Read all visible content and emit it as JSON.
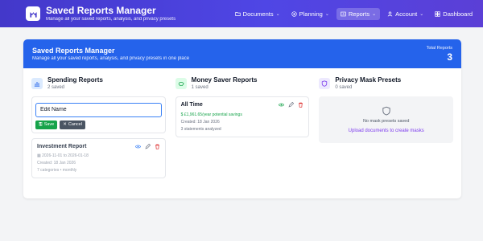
{
  "header": {
    "title": "Saved Reports Manager",
    "subtitle": "Manage all your saved reports, analysis, and privacy presets",
    "nav": [
      {
        "label": "Documents",
        "icon": "folder-icon"
      },
      {
        "label": "Planning",
        "icon": "target-icon"
      },
      {
        "label": "Reports",
        "icon": "report-icon",
        "active": true
      },
      {
        "label": "Account",
        "icon": "user-icon"
      },
      {
        "label": "Dashboard",
        "icon": "dashboard-icon"
      }
    ]
  },
  "banner": {
    "title": "Saved Reports Manager",
    "subtitle": "Manage all your saved reports, analysis, and privacy presets in one place",
    "total_label": "Total Reports",
    "total_value": "3"
  },
  "spending": {
    "title": "Spending Reports",
    "count": "2 saved",
    "edit_value": "Edit Name",
    "save_label": "Save",
    "cancel_label": "Cancel",
    "report": {
      "title": "Investment Report",
      "dates": "2026-11-01 to 2026-01-18",
      "created": "Created: 18 Jan 2026",
      "details": "7 categories • monthly"
    }
  },
  "money_saver": {
    "title": "Money Saver Reports",
    "count": "1 saved",
    "report": {
      "title": "All Time",
      "savings": "£1,961.65/year potential savings",
      "created": "Created: 18 Jan 2026",
      "statements": "3 statements analyzed"
    }
  },
  "privacy": {
    "title": "Privacy Mask Presets",
    "count": "0 saved",
    "empty_text": "No mask presets saved",
    "empty_link": "Upload documents to create masks"
  },
  "colors": {
    "nav_bg": "#4f46e5",
    "banner_bg": "#2563eb",
    "save_green": "#16a34a",
    "link_purple": "#7c3aed"
  }
}
